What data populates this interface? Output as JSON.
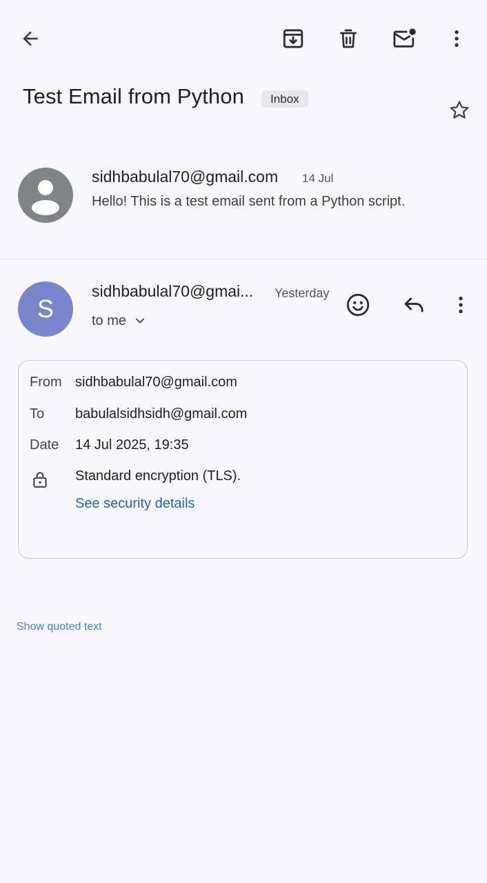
{
  "toolbar": {
    "back_icon": "arrow-left-icon",
    "archive_icon": "archive-icon",
    "delete_icon": "trash-icon",
    "mark_unread_icon": "mail-unread-icon",
    "more_icon": "more-vertical-icon"
  },
  "email": {
    "subject": "Test Email from Python",
    "label": "Inbox",
    "star_icon": "star-outline-icon"
  },
  "messages": [
    {
      "sender": "sidhbabulal70@gmail.com",
      "date": "14 Jul",
      "snippet": "Hello! This is a test email sent from a Python script.",
      "avatar_icon": "person-icon"
    },
    {
      "sender": "sidhbabulal70@gmai...",
      "date": "Yesterday",
      "avatar_letter": "S",
      "recipient_summary": "to me",
      "actions": {
        "emoji_icon": "smiley-icon",
        "reply_icon": "reply-icon",
        "more_icon": "more-vertical-icon"
      }
    }
  ],
  "details": {
    "from_label": "From",
    "from_value": "sidhbabulal70@gmail.com",
    "to_label": "To",
    "to_value": "babulalsidhsidh@gmail.com",
    "date_label": "Date",
    "date_value": "14 Jul 2025, 19:35",
    "encryption_icon": "lock-icon",
    "encryption_text": "Standard encryption (TLS).",
    "security_link": "See security details"
  },
  "footer": {
    "show_quoted": "Show quoted text"
  },
  "colors": {
    "background": "#f7f7fc",
    "avatar_s": "#7986cb",
    "avatar_grey": "#7f8487",
    "link": "#1b64b8"
  }
}
